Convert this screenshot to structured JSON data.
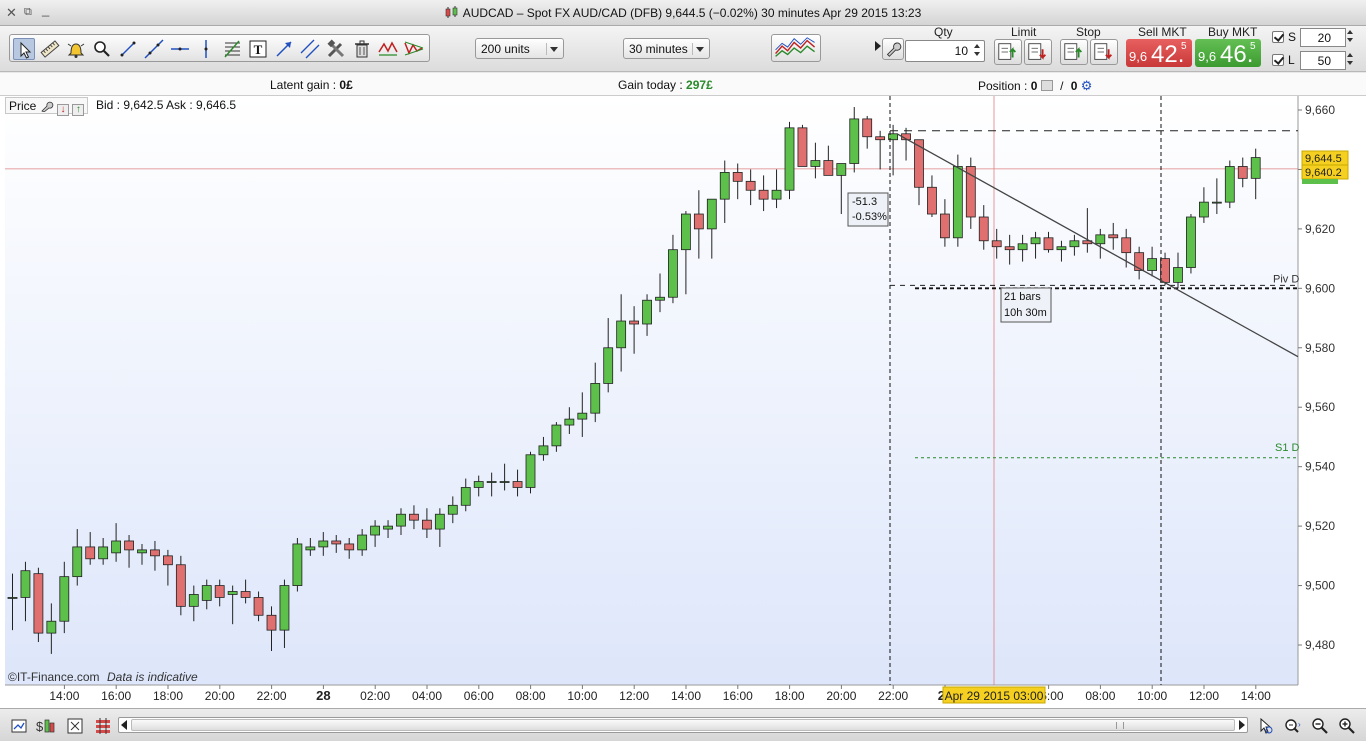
{
  "window": {
    "title": "AUDCAD – Spot FX AUD/CAD (DFB)     9,644.5 (−0.02%)     30 minutes  Apr 29 2015 13:23",
    "icons": [
      "close-icon",
      "restore-icon",
      "minimize-icon"
    ]
  },
  "toolbar": {
    "tools": [
      "cursor-icon",
      "ruler-icon",
      "alarm-bell-icon",
      "magnifier-icon",
      "segment-icon",
      "trendline-icon",
      "horizontal-line-icon",
      "vertical-line-icon",
      "fibonacci-icon",
      "text-tool-icon",
      "arrow-line-icon",
      "channel-icon",
      "tools-icon",
      "trash-icon",
      "pattern-icon",
      "triangle-pattern-icon"
    ],
    "units": "200 units",
    "interval": "30 minutes"
  },
  "order": {
    "qty_label": "Qty",
    "qty_value": "10",
    "limit_label": "Limit",
    "stop_label": "Stop",
    "sell_label": "Sell MKT",
    "sell_small": "9,6",
    "sell_big": "42.",
    "sell_sup": "5",
    "buy_label": "Buy MKT",
    "buy_small": "9,6",
    "buy_big": "46.",
    "buy_sup": "5",
    "s_label": "S",
    "s_value": "20",
    "l_label": "L",
    "l_value": "50",
    "sell_color": "#d84a4a",
    "buy_color": "#4aaa3a"
  },
  "info": {
    "latent_label": "Latent gain : ",
    "latent_value": "0£",
    "gain_label": "Gain today : ",
    "gain_value": "297£",
    "position_label": "Position : ",
    "position_value1": "0",
    "position_sep": "/",
    "position_value2": "0"
  },
  "chart_panel": {
    "price_label": "Price",
    "bidask": "Bid : 9,642.5 Ask : 9,646.5",
    "copyright": "©IT-Finance.com",
    "indicative": "Data is indicative"
  },
  "chart_data": {
    "type": "candlestick",
    "instrument": "AUDCAD",
    "interval": "30 minutes",
    "ylim": [
      9466,
      9676
    ],
    "y_ticks": [
      "9,660",
      "9,640",
      "9,620",
      "9,600",
      "9,580",
      "9,560",
      "9,540",
      "9,520",
      "9,500",
      "9,480"
    ],
    "x_ticks": [
      "14:00",
      "16:00",
      "18:00",
      "20:00",
      "22:00",
      "28",
      "02:00",
      "04:00",
      "06:00",
      "08:00",
      "10:00",
      "12:00",
      "14:00",
      "16:00",
      "18:00",
      "20:00",
      "22:00",
      "29",
      "06:00",
      "08:00",
      "10:00",
      "12:00",
      "14:00"
    ],
    "x_highlight": "Apr 29 2015 03:00",
    "current_ask": "9,644.5",
    "current_bid": "9,640.2",
    "levels": [
      {
        "name": "Piv D",
        "value": 9601
      },
      {
        "name": "S1 D",
        "value": 9543
      },
      {
        "name": "",
        "value": 9653
      }
    ],
    "measure_box_1": [
      "-51.3",
      "-0.53%"
    ],
    "measure_box_2": [
      "21 bars",
      "10h 30m"
    ],
    "candles": [
      [
        9496,
        9504,
        9485,
        9496
      ],
      [
        9496,
        9508,
        9488,
        9505
      ],
      [
        9504,
        9506,
        9481,
        9484
      ],
      [
        9484,
        9494,
        9477,
        9488
      ],
      [
        9488,
        9508,
        9484,
        9503
      ],
      [
        9503,
        9519,
        9500,
        9513
      ],
      [
        9513,
        9518,
        9507,
        9509
      ],
      [
        9509,
        9516,
        9507,
        9513
      ],
      [
        9511,
        9521,
        9508,
        9515
      ],
      [
        9515,
        9517,
        9506,
        9512
      ],
      [
        9511,
        9514,
        9507,
        9512
      ],
      [
        9512,
        9515,
        9505,
        9510
      ],
      [
        9510,
        9512,
        9500,
        9507
      ],
      [
        9507,
        9510,
        9490,
        9493
      ],
      [
        9493,
        9500,
        9488,
        9497
      ],
      [
        9495,
        9502,
        9492,
        9500
      ],
      [
        9500,
        9502,
        9493,
        9496
      ],
      [
        9497,
        9500,
        9487,
        9498
      ],
      [
        9498,
        9502,
        9494,
        9496
      ],
      [
        9496,
        9498,
        9488,
        9490
      ],
      [
        9490,
        9493,
        9478,
        9485
      ],
      [
        9485,
        9502,
        9479,
        9500
      ],
      [
        9500,
        9516,
        9498,
        9514
      ],
      [
        9512,
        9516,
        9510,
        9513
      ],
      [
        9513,
        9518,
        9510,
        9515
      ],
      [
        9515,
        9517,
        9511,
        9514
      ],
      [
        9514,
        9516,
        9509,
        9512
      ],
      [
        9512,
        9519,
        9510,
        9517
      ],
      [
        9517,
        9522,
        9513,
        9520
      ],
      [
        9519,
        9522,
        9516,
        9520
      ],
      [
        9520,
        9526,
        9517,
        9524
      ],
      [
        9524,
        9527,
        9519,
        9522
      ],
      [
        9522,
        9526,
        9516,
        9519
      ],
      [
        9519,
        9526,
        9513,
        9524
      ],
      [
        9524,
        9530,
        9521,
        9527
      ],
      [
        9527,
        9536,
        9525,
        9533
      ],
      [
        9533,
        9537,
        9530,
        9535
      ],
      [
        9535,
        9538,
        9530,
        9535
      ],
      [
        9535,
        9541,
        9532,
        9535
      ],
      [
        9535,
        9539,
        9530,
        9533
      ],
      [
        9533,
        9545,
        9531,
        9544
      ],
      [
        9544,
        9550,
        9542,
        9547
      ],
      [
        9547,
        9555,
        9545,
        9554
      ],
      [
        9554,
        9560,
        9551,
        9556
      ],
      [
        9556,
        9565,
        9550,
        9558
      ],
      [
        9558,
        9575,
        9555,
        9568
      ],
      [
        9568,
        9590,
        9565,
        9580
      ],
      [
        9580,
        9598,
        9572,
        9589
      ],
      [
        9589,
        9594,
        9578,
        9588
      ],
      [
        9588,
        9598,
        9584,
        9596
      ],
      [
        9596,
        9605,
        9592,
        9597
      ],
      [
        9597,
        9618,
        9595,
        9613
      ],
      [
        9613,
        9626,
        9598,
        9625
      ],
      [
        9625,
        9633,
        9610,
        9620
      ],
      [
        9620,
        9630,
        9610,
        9630
      ],
      [
        9630,
        9643,
        9622,
        9639
      ],
      [
        9639,
        9642,
        9630,
        9636
      ],
      [
        9636,
        9640,
        9628,
        9633
      ],
      [
        9633,
        9638,
        9626,
        9630
      ],
      [
        9630,
        9640,
        9627,
        9633
      ],
      [
        9633,
        9656,
        9630,
        9654
      ],
      [
        9654,
        9655,
        9642,
        9641
      ],
      [
        9641,
        9649,
        9637,
        9643
      ],
      [
        9643,
        9648,
        9638,
        9638
      ],
      [
        9638,
        9642,
        9625,
        9642
      ],
      [
        9642,
        9661,
        9639,
        9657
      ],
      [
        9657,
        9658,
        9647,
        9651
      ],
      [
        9651,
        9653,
        9640,
        9650
      ],
      [
        9650,
        9655,
        9638,
        9652
      ],
      [
        9652,
        9654,
        9643,
        9650
      ],
      [
        9650,
        9649,
        9628,
        9634
      ],
      [
        9634,
        9638,
        9624,
        9625
      ],
      [
        9625,
        9630,
        9614,
        9617
      ],
      [
        9617,
        9645,
        9614,
        9641
      ],
      [
        9641,
        9644,
        9620,
        9624
      ],
      [
        9624,
        9628,
        9613,
        9616
      ],
      [
        9616,
        9620,
        9610,
        9614
      ],
      [
        9614,
        9618,
        9608,
        9613
      ],
      [
        9613,
        9618,
        9609,
        9615
      ],
      [
        9615,
        9619,
        9610,
        9617
      ],
      [
        9617,
        9619,
        9612,
        9613
      ],
      [
        9613,
        9616,
        9609,
        9614
      ],
      [
        9614,
        9618,
        9611,
        9616
      ],
      [
        9616,
        9627,
        9612,
        9615
      ],
      [
        9615,
        9620,
        9610,
        9618
      ],
      [
        9618,
        9622,
        9613,
        9617
      ],
      [
        9617,
        9620,
        9607,
        9612
      ],
      [
        9612,
        9614,
        9603,
        9606
      ],
      [
        9606,
        9614,
        9604,
        9610
      ],
      [
        9610,
        9612,
        9601,
        9602
      ],
      [
        9602,
        9612,
        9600,
        9607
      ],
      [
        9607,
        9625,
        9605,
        9624
      ],
      [
        9624,
        9634,
        9622,
        9629
      ],
      [
        9629,
        9637,
        9625,
        9629
      ],
      [
        9629,
        9643,
        9627,
        9641
      ],
      [
        9641,
        9644,
        9634,
        9637
      ],
      [
        9637,
        9647,
        9630,
        9644
      ]
    ]
  },
  "bottom": {
    "icons": [
      "screenshot-icon",
      "indicator-icon",
      "layout-icon",
      "bars-icon"
    ],
    "right_icons": [
      "pointer-zoom-icon",
      "zoom-fit-icon",
      "zoom-out-icon",
      "zoom-in-icon"
    ]
  }
}
